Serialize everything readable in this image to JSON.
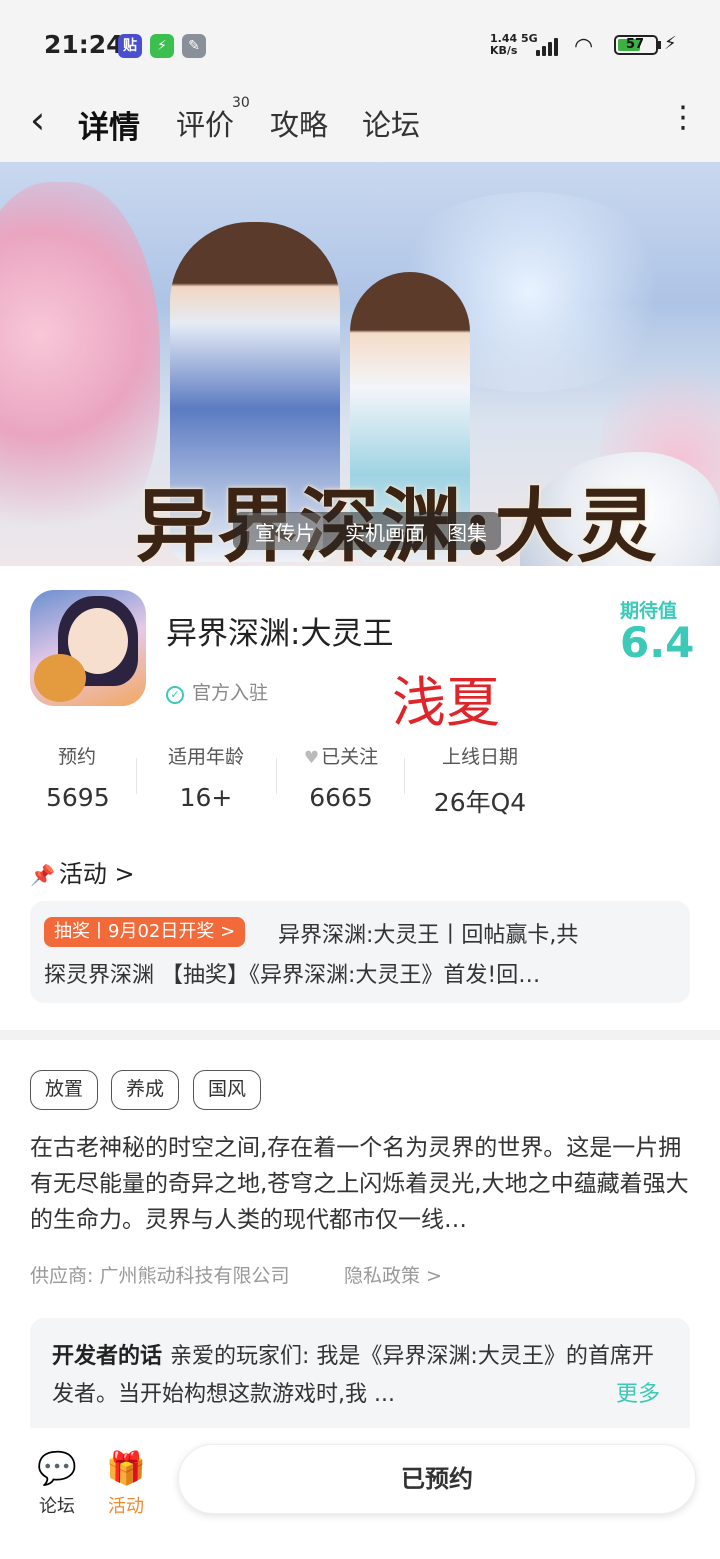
{
  "status_bar": {
    "time": "21:24",
    "net_speed_top": "1.44",
    "net_speed_unit": "KB/s",
    "network": "5G",
    "battery": "57",
    "app_icon_1": "贴"
  },
  "nav": {
    "tabs": [
      {
        "label": "详情",
        "active": true
      },
      {
        "label": "评价",
        "count": "30"
      },
      {
        "label": "攻略"
      },
      {
        "label": "论坛"
      }
    ]
  },
  "banner": {
    "title": "异界深渊:大灵王",
    "media_tabs": [
      "宣传片",
      "实机画面",
      "图集"
    ]
  },
  "app": {
    "name": "异界深渊:大灵王",
    "official_label": "官方入驻",
    "watermark": "浅夏",
    "expect_label": "期待值",
    "expect_value": "6.4"
  },
  "stats": [
    {
      "label": "预约",
      "value": "5695"
    },
    {
      "label": "适用年龄",
      "value": "16+"
    },
    {
      "label": "已关注",
      "value": "6665"
    },
    {
      "label": "上线日期",
      "value": "26年Q4"
    }
  ],
  "activity": {
    "heading": "活动 >",
    "badge": "抽奖丨9月02日开奖 >",
    "line1": "异界深渊:大灵王丨回帖赢卡,共",
    "line2": "探灵界深渊 【抽奖】《异界深渊:大灵王》首发!回…"
  },
  "tags": [
    "放置",
    "养成",
    "国风"
  ],
  "description": "在古老神秘的时空之间,存在着一个名为灵界的世界。这是一片拥有无尽能量的奇异之地,苍穹之上闪烁着灵光,大地之中蕴藏着强大的生命力。灵界与人类的现代都市仅一线…",
  "vendor": {
    "label": "供应商:",
    "name": "广州熊动科技有限公司",
    "privacy": "隐私政策 >"
  },
  "developer": {
    "heading": "开发者的话",
    "text": "亲爱的玩家们: 我是《异界深渊:大灵王》的首席开发者。当开始构想这款游戏时,我 ...",
    "more": "更多"
  },
  "bottom_bar": {
    "forum_label": "论坛",
    "activity_label": "活动",
    "reserve_label": "已预约"
  },
  "colors": {
    "accent": "#3cc9b7",
    "badge": "#f26a3a",
    "watermark": "#e0252a",
    "active_tab_icon": "#f0892f"
  }
}
